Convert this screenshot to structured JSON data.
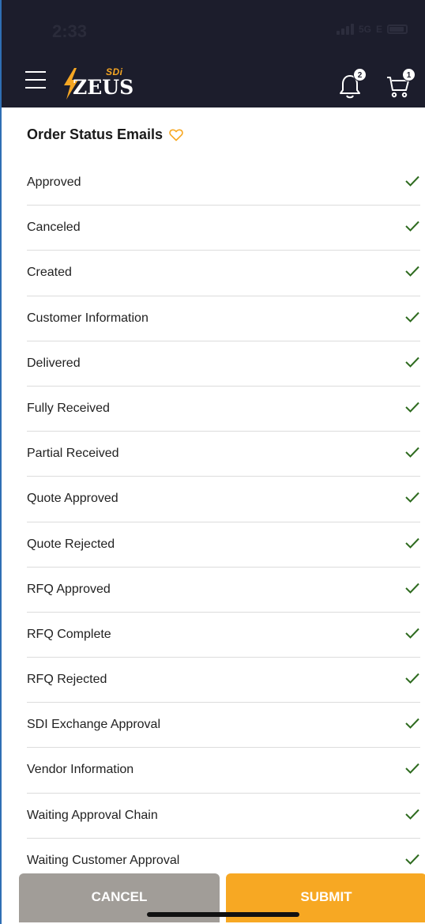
{
  "status_bar": {
    "time": "2:33",
    "network": "5G",
    "network_suffix": "E"
  },
  "header": {
    "logo_top": "SDi",
    "logo_main": "ZEUS",
    "notification_count": "2",
    "cart_count": "1"
  },
  "section": {
    "title": "Order Status Emails"
  },
  "items": [
    {
      "label": "Approved",
      "checked": true
    },
    {
      "label": "Canceled",
      "checked": true
    },
    {
      "label": "Created",
      "checked": true
    },
    {
      "label": "Customer Information",
      "checked": true
    },
    {
      "label": "Delivered",
      "checked": true
    },
    {
      "label": "Fully Received",
      "checked": true
    },
    {
      "label": "Partial Received",
      "checked": true
    },
    {
      "label": "Quote Approved",
      "checked": true
    },
    {
      "label": "Quote Rejected",
      "checked": true
    },
    {
      "label": "RFQ Approved",
      "checked": true
    },
    {
      "label": "RFQ Complete",
      "checked": true
    },
    {
      "label": "RFQ Rejected",
      "checked": true
    },
    {
      "label": "SDI Exchange Approval",
      "checked": true
    },
    {
      "label": "Vendor Information",
      "checked": true
    },
    {
      "label": "Waiting Approval Chain",
      "checked": true
    },
    {
      "label": "Waiting Customer Approval",
      "checked": true
    }
  ],
  "footer": {
    "cancel_label": "CANCEL",
    "submit_label": "SUBMIT"
  },
  "colors": {
    "header_bg": "#1c1d2c",
    "accent": "#f7a823",
    "check": "#2e6b1f",
    "cancel_bg": "#a19d98"
  }
}
